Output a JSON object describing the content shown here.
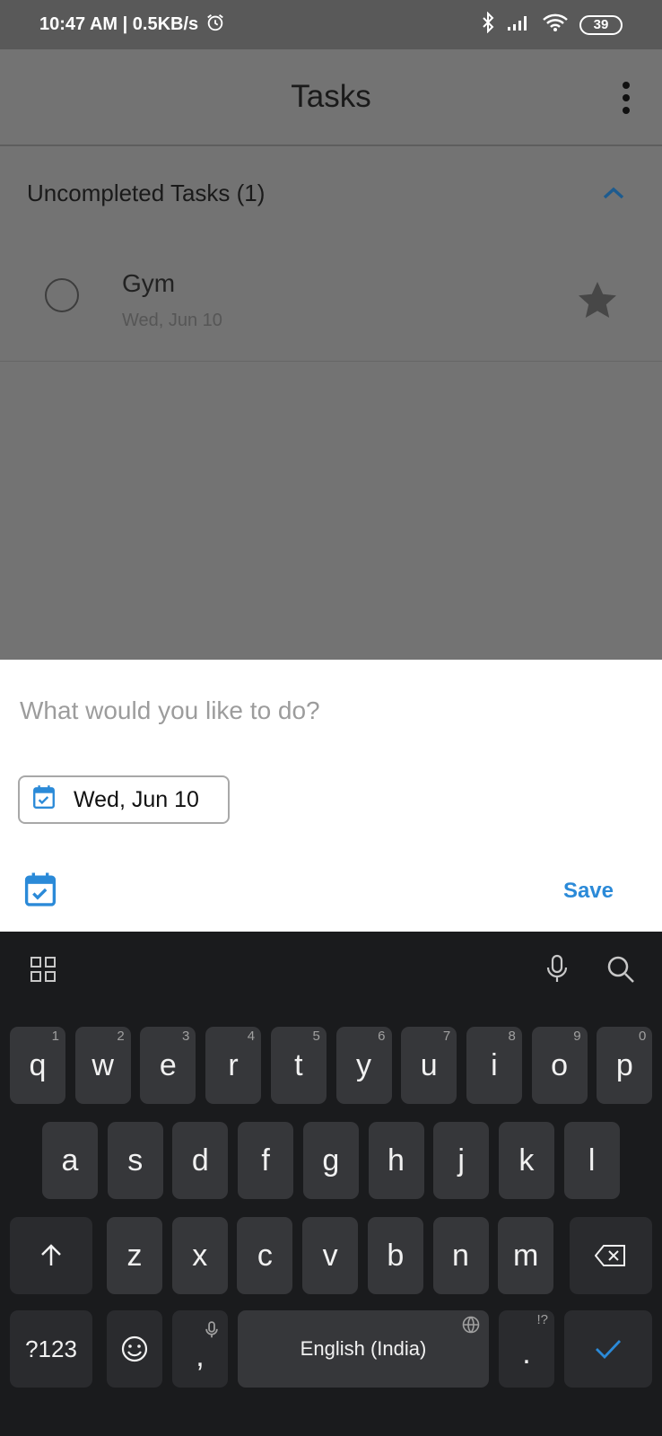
{
  "status_bar": {
    "time_speed": "10:47 AM | 0.5KB/s",
    "battery": "39"
  },
  "app_bar": {
    "title": "Tasks"
  },
  "section": {
    "title": "Uncompleted Tasks (1)"
  },
  "tasks": [
    {
      "title": "Gym",
      "date": "Wed, Jun 10",
      "starred": true
    }
  ],
  "sheet": {
    "placeholder": "What would you like to do?",
    "date_chip": "Wed, Jun 10",
    "save_label": "Save"
  },
  "colors": {
    "accent": "#2b8ad8",
    "overlay": "#737373",
    "keyboard_bg": "#1a1b1d",
    "key_bg": "#36373a"
  },
  "keyboard": {
    "row1": [
      {
        "label": "q",
        "hint": "1"
      },
      {
        "label": "w",
        "hint": "2"
      },
      {
        "label": "e",
        "hint": "3"
      },
      {
        "label": "r",
        "hint": "4"
      },
      {
        "label": "t",
        "hint": "5"
      },
      {
        "label": "y",
        "hint": "6"
      },
      {
        "label": "u",
        "hint": "7"
      },
      {
        "label": "i",
        "hint": "8"
      },
      {
        "label": "o",
        "hint": "9"
      },
      {
        "label": "p",
        "hint": "0"
      }
    ],
    "row2": [
      "a",
      "s",
      "d",
      "f",
      "g",
      "h",
      "j",
      "k",
      "l"
    ],
    "row3": [
      "z",
      "x",
      "c",
      "v",
      "b",
      "n",
      "m"
    ],
    "symbols_label": "?123",
    "comma_label": ",",
    "space_label": "English (India)",
    "period_label": ".",
    "period_hint": "!?"
  }
}
